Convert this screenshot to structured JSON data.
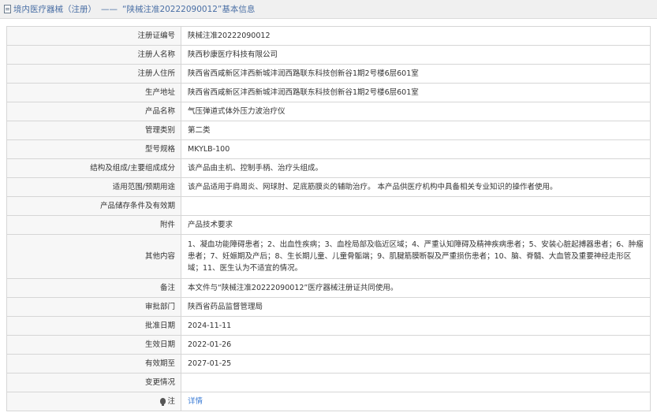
{
  "header": {
    "left": "境内医疗器械（注册）",
    "sep": "——",
    "right": "“陕械注准20222090012”基本信息"
  },
  "rows": [
    {
      "label": "注册证编号",
      "value": "陕械注准20222090012"
    },
    {
      "label": "注册人名称",
      "value": "陕西秒康医疗科技有限公司"
    },
    {
      "label": "注册人住所",
      "value": "陕西省西咸新区沣西新城沣润西路联东科技创新谷1期2号楼6层601室"
    },
    {
      "label": "生产地址",
      "value": "陕西省西咸新区沣西新城沣润西路联东科技创新谷1期2号楼6层601室"
    },
    {
      "label": "产品名称",
      "value": "气压弹道式体外压力波治疗仪"
    },
    {
      "label": "管理类别",
      "value": "第二类"
    },
    {
      "label": "型号规格",
      "value": "MKYLB-100"
    },
    {
      "label": "结构及组成/主要组成成分",
      "value": "该产品由主机、控制手柄、治疗头组成。"
    },
    {
      "label": "适用范围/预期用途",
      "value": "该产品适用于肩周炎、网球肘、足底筋膜炎的辅助治疗。 本产品供医疗机构中具备相关专业知识的操作者使用。"
    },
    {
      "label": "产品储存条件及有效期",
      "value": ""
    },
    {
      "label": "附件",
      "value": "产品技术要求"
    },
    {
      "label": "其他内容",
      "value": "1、凝血功能障碍患者；2、出血性疾病；3、血栓局部及临近区域；4、严重认知障碍及精神疾病患者；5、安装心脏起搏器患者；6、肿瘤患者；7、妊娠期及产后；8、生长期儿童、儿童骨骺端；9、肌腱筋膜断裂及严重损伤患者；10、脑、脊髓、大血管及重要神经走形区域；11、医生认为不适宜的情况。"
    },
    {
      "label": "备注",
      "value": "本文件与“陕械注准20222090012”医疗器械注册证共同使用。"
    },
    {
      "label": "审批部门",
      "value": "陕西省药品监督管理局"
    },
    {
      "label": "批准日期",
      "value": "2024-11-11"
    },
    {
      "label": "生效日期",
      "value": "2022-01-26"
    },
    {
      "label": "有效期至",
      "value": "2027-01-25"
    },
    {
      "label": "变更情况",
      "value": ""
    }
  ],
  "note": {
    "label": "注",
    "link": "详情"
  }
}
